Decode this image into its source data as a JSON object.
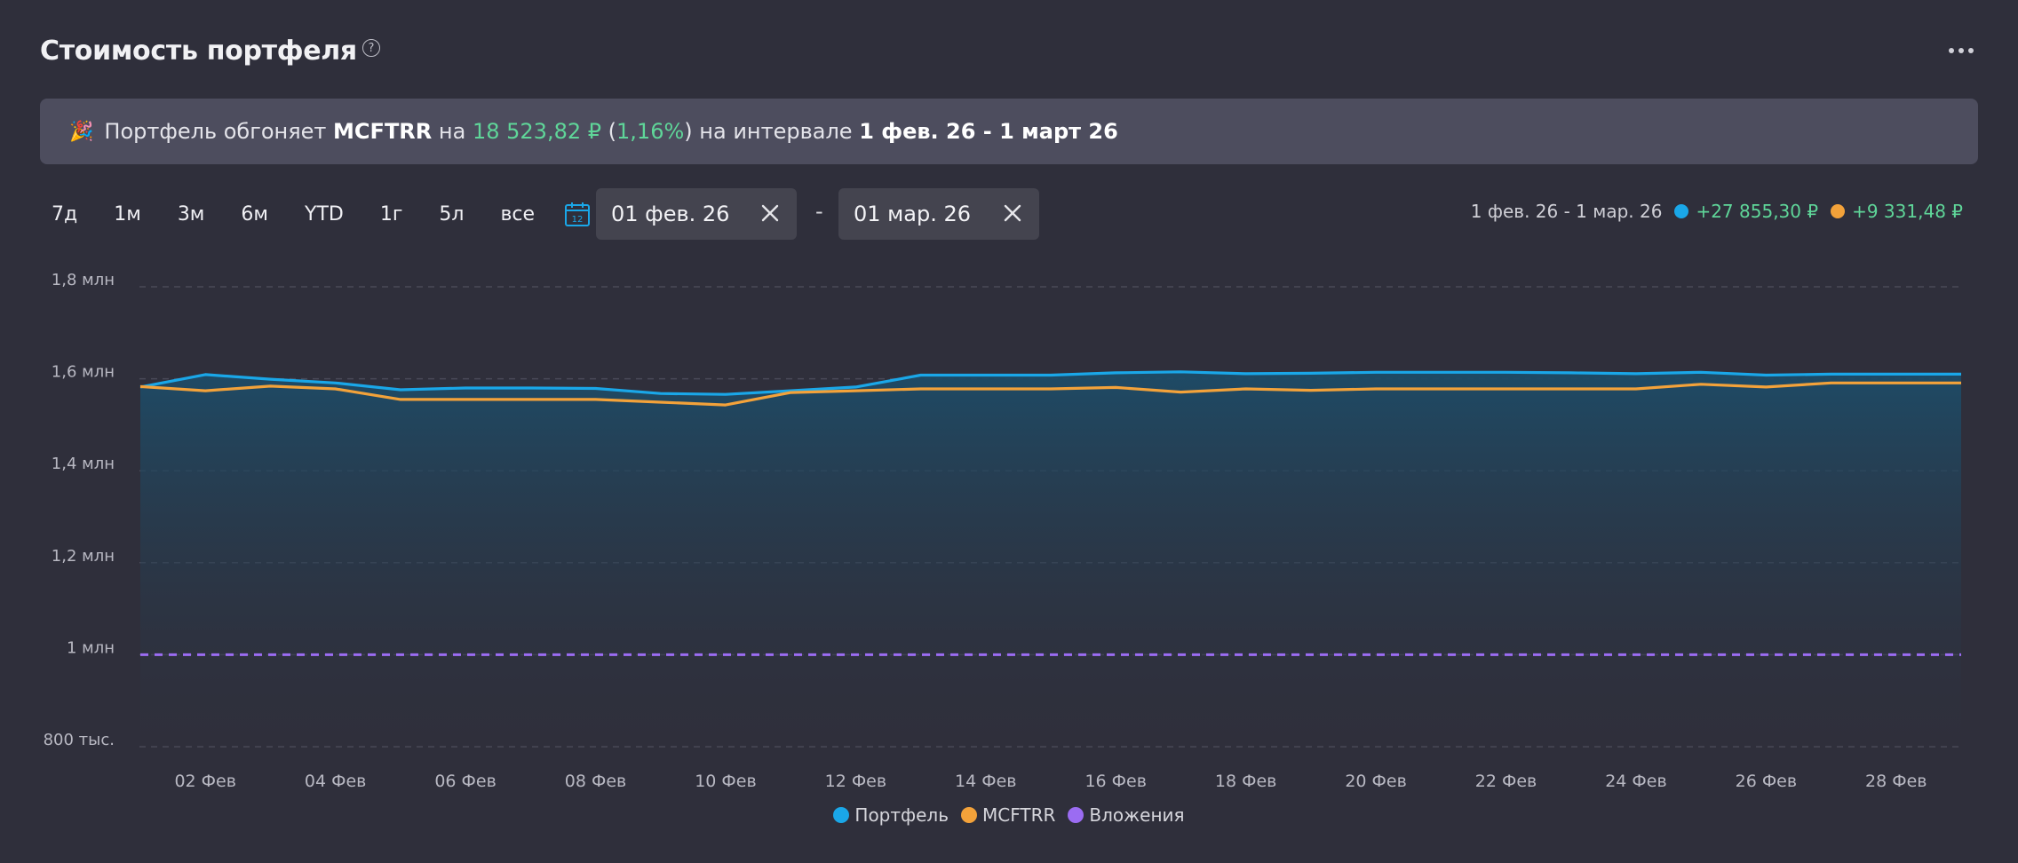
{
  "header": {
    "title": "Стоимость портфеля",
    "help_glyph": "?"
  },
  "banner": {
    "icon": "party-popper-icon",
    "text_before": "Портфель обгоняет",
    "benchmark": "MCFTRR",
    "word_na": "на",
    "amount": "18 523,82 ₽",
    "paren_open": "(",
    "percent": "1,16%",
    "paren_close": ")",
    "text_interval": "на интервале",
    "interval": "1 фев. 26 - 1 март 26"
  },
  "periods": [
    "7д",
    "1м",
    "3м",
    "6м",
    "YTD",
    "1г",
    "5л",
    "все"
  ],
  "calendar_day": "12",
  "date_range": {
    "from": "01 фев. 26",
    "dash": "-",
    "to": "01 мар. 26"
  },
  "summary": {
    "range": "1 фев. 26 - 1 мар. 26",
    "portfolio_change": "+27 855,30 ₽",
    "benchmark_change": "+9 331,48 ₽"
  },
  "colors": {
    "portfolio": "#1aa7e8",
    "benchmark": "#f3a23a",
    "investments": "#9b6cf2",
    "positive": "#5fd699"
  },
  "chart_data": {
    "type": "line",
    "y_range": [
      800000,
      1800000
    ],
    "y_ticks": [
      {
        "value": 1800000,
        "label": "1,8 млн"
      },
      {
        "value": 1600000,
        "label": "1,6 млн"
      },
      {
        "value": 1400000,
        "label": "1,4 млн"
      },
      {
        "value": 1200000,
        "label": "1,2 млн"
      },
      {
        "value": 1000000,
        "label": "1 млн"
      },
      {
        "value": 800000,
        "label": "800 тыс."
      }
    ],
    "x_range": [
      1,
      29
    ],
    "x_ticks": [
      {
        "day": 2,
        "label": "02 Фев"
      },
      {
        "day": 4,
        "label": "04 Фев"
      },
      {
        "day": 6,
        "label": "06 Фев"
      },
      {
        "day": 8,
        "label": "08 Фев"
      },
      {
        "day": 10,
        "label": "10 Фев"
      },
      {
        "day": 12,
        "label": "12 Фев"
      },
      {
        "day": 14,
        "label": "14 Фев"
      },
      {
        "day": 16,
        "label": "16 Фев"
      },
      {
        "day": 18,
        "label": "18 Фев"
      },
      {
        "day": 20,
        "label": "20 Фев"
      },
      {
        "day": 22,
        "label": "22 Фев"
      },
      {
        "day": 24,
        "label": "24 Фев"
      },
      {
        "day": 26,
        "label": "26 Фев"
      },
      {
        "day": 28,
        "label": "28 Фев"
      }
    ],
    "grid": true,
    "legend_position": "bottom-center",
    "series": [
      {
        "name": "Портфель",
        "color": "#1aa7e8",
        "area": true,
        "points": [
          [
            1,
            1582000
          ],
          [
            2,
            1609000
          ],
          [
            3,
            1599000
          ],
          [
            4,
            1591000
          ],
          [
            5,
            1576000
          ],
          [
            6,
            1580000
          ],
          [
            7,
            1580000
          ],
          [
            8,
            1579000
          ],
          [
            9,
            1568000
          ],
          [
            10,
            1566000
          ],
          [
            11,
            1574000
          ],
          [
            12,
            1582000
          ],
          [
            13,
            1608000
          ],
          [
            14,
            1608000
          ],
          [
            15,
            1608000
          ],
          [
            16,
            1613000
          ],
          [
            17,
            1615000
          ],
          [
            18,
            1611000
          ],
          [
            19,
            1612000
          ],
          [
            20,
            1614000
          ],
          [
            21,
            1614000
          ],
          [
            22,
            1614000
          ],
          [
            23,
            1613000
          ],
          [
            24,
            1611000
          ],
          [
            25,
            1614000
          ],
          [
            26,
            1608000
          ],
          [
            27,
            1610000
          ],
          [
            28,
            1610000
          ],
          [
            29,
            1610000
          ]
        ]
      },
      {
        "name": "MCFTRR",
        "color": "#f3a23a",
        "area": false,
        "points": [
          [
            1,
            1583000
          ],
          [
            2,
            1574000
          ],
          [
            3,
            1584000
          ],
          [
            4,
            1578000
          ],
          [
            5,
            1555000
          ],
          [
            6,
            1555000
          ],
          [
            7,
            1555000
          ],
          [
            8,
            1555000
          ],
          [
            9,
            1549000
          ],
          [
            10,
            1543000
          ],
          [
            11,
            1570000
          ],
          [
            12,
            1574000
          ],
          [
            13,
            1578000
          ],
          [
            14,
            1578000
          ],
          [
            15,
            1578000
          ],
          [
            16,
            1581000
          ],
          [
            17,
            1571000
          ],
          [
            18,
            1578000
          ],
          [
            19,
            1575000
          ],
          [
            20,
            1578000
          ],
          [
            21,
            1578000
          ],
          [
            22,
            1578000
          ],
          [
            23,
            1578000
          ],
          [
            24,
            1578000
          ],
          [
            25,
            1588000
          ],
          [
            26,
            1582000
          ],
          [
            27,
            1591000
          ],
          [
            28,
            1591000
          ],
          [
            29,
            1591000
          ]
        ]
      },
      {
        "name": "Вложения",
        "color": "#9b6cf2",
        "dashed": true,
        "points": [
          [
            1,
            1000000
          ],
          [
            29,
            1000000
          ]
        ]
      }
    ]
  }
}
